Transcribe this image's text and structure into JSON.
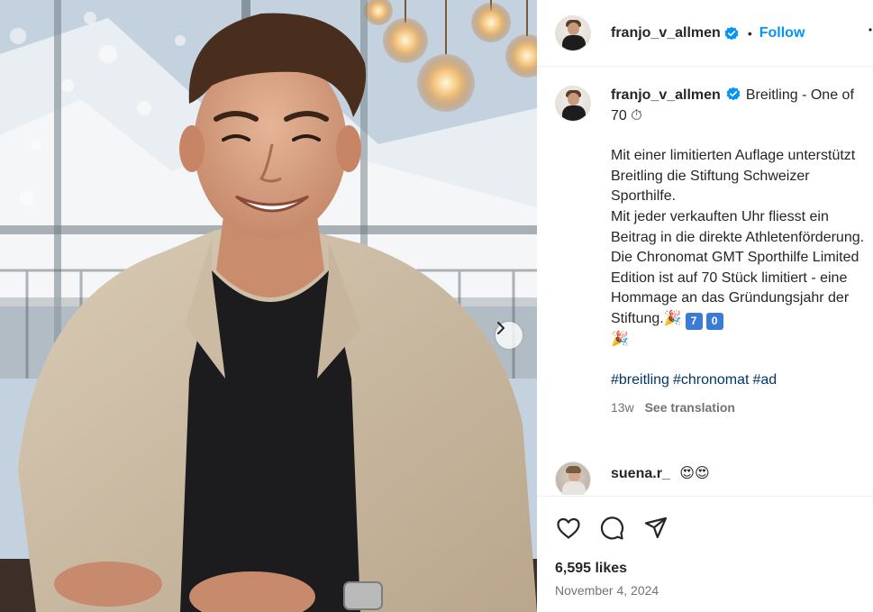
{
  "post": {
    "author": "franjo_v_allmen",
    "separator": "•",
    "follow_label": "Follow",
    "caption_title": "Breitling - One of 70",
    "caption_title_emoji": "⏱",
    "caption_body": "Mit einer limitierten Auflage unterstützt Breitling die Stiftung Schweizer Sporthilfe.\nMit jeder verkauften Uhr fliesst ein Beitrag in die direkte Athletenförderung.\nDie Chronomat GMT Sporthilfe Limited Edition ist auf 70 Stück limitiert - eine Hommage an das Gründungsjahr der Stiftung.",
    "caption_emojis": [
      "🎉",
      "7",
      "0",
      "🎉"
    ],
    "hashtags": [
      "#breitling",
      "#chronomat",
      "#ad"
    ],
    "age": "13w",
    "see_translation": "See translation",
    "likes": "6,595 likes",
    "date": "November 4, 2024"
  },
  "reply": {
    "username": "suena.r_",
    "emojis": "😍😍"
  },
  "icons": {
    "like": "heart-icon",
    "comment": "comment-icon",
    "share": "paper-plane-icon",
    "verified": "verified-badge-icon",
    "more": "more-options-icon",
    "next": "chevron-right-icon"
  },
  "colors": {
    "accent": "#0095f6",
    "verified": "#0095f6",
    "hashtag": "#00376b",
    "muted": "#737373"
  }
}
